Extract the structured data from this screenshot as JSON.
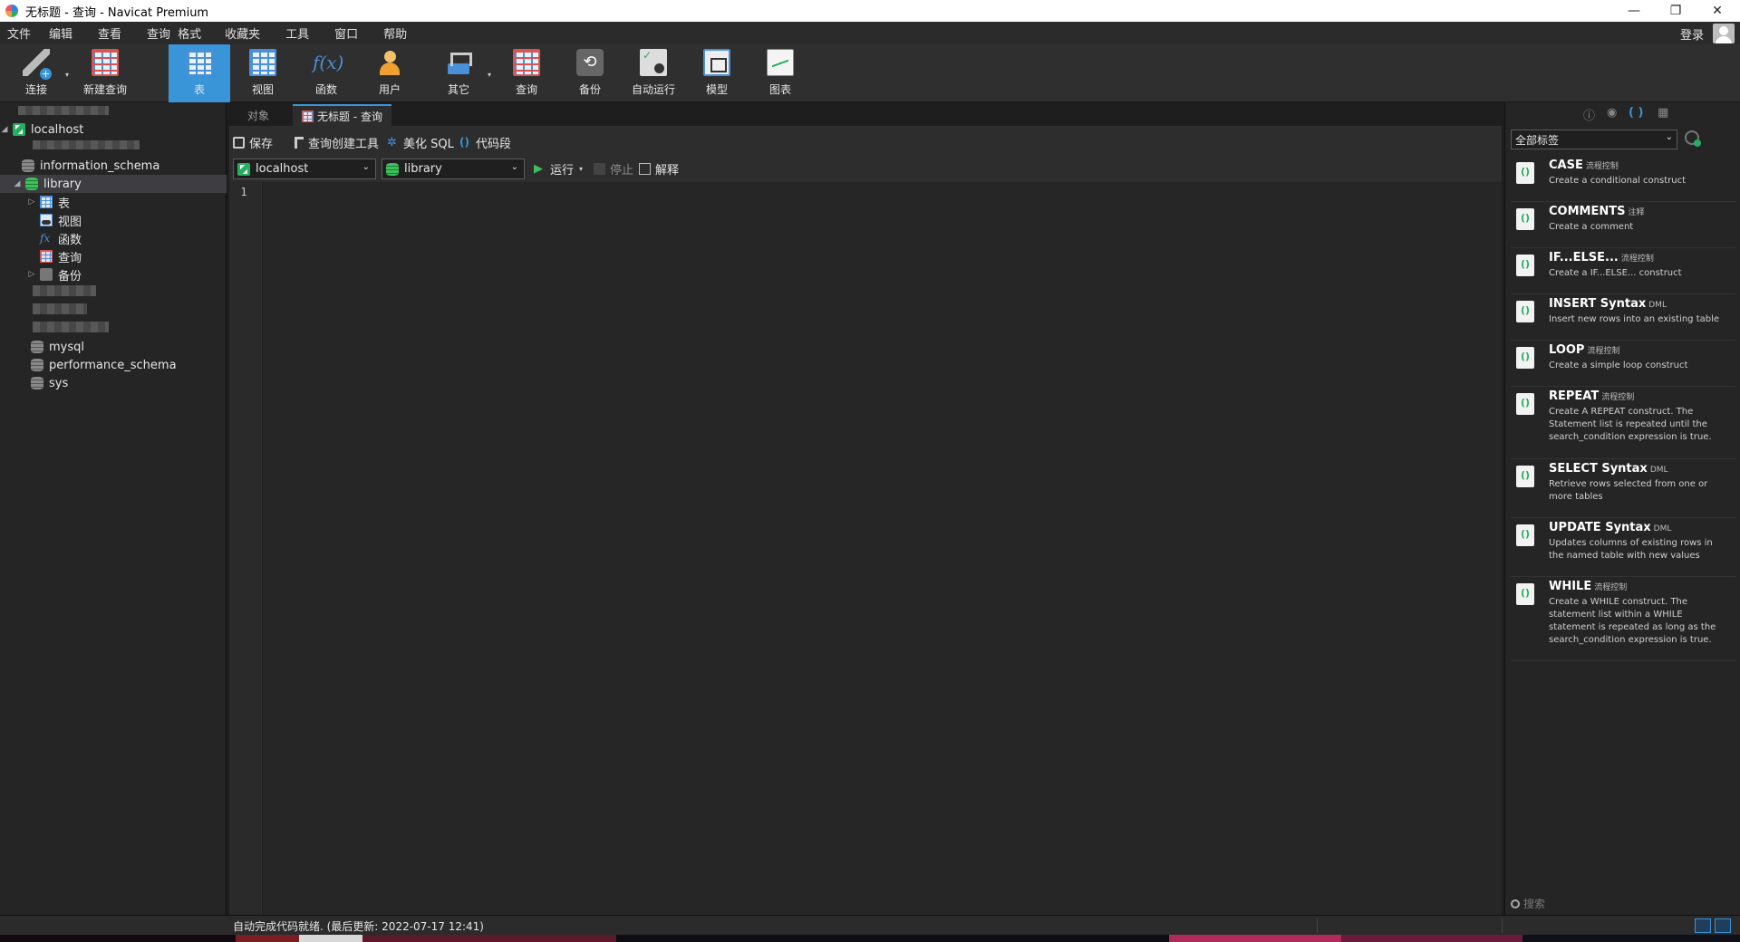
{
  "window": {
    "title": "无标题 - 查询 - Navicat Premium",
    "minimize_glyph": "—",
    "restore_glyph": "❐",
    "close_glyph": "✕"
  },
  "menu": {
    "items": [
      "文件",
      "编辑",
      "查看",
      "查询",
      "格式",
      "收藏夹",
      "工具",
      "窗口",
      "帮助"
    ],
    "login": "登录"
  },
  "toolbar": {
    "buttons": [
      {
        "label": "连接",
        "icon": "connection-plug-icon"
      },
      {
        "label": "新建查询",
        "icon": "new-query-icon"
      },
      {
        "label": "表",
        "icon": "table-icon",
        "active": true
      },
      {
        "label": "视图",
        "icon": "view-icon"
      },
      {
        "label": "函数",
        "icon": "function-icon"
      },
      {
        "label": "用户",
        "icon": "user-icon"
      },
      {
        "label": "其它",
        "icon": "other-tools-icon"
      },
      {
        "label": "查询",
        "icon": "query-icon"
      },
      {
        "label": "备份",
        "icon": "backup-icon"
      },
      {
        "label": "自动运行",
        "icon": "automation-icon"
      },
      {
        "label": "模型",
        "icon": "model-icon"
      },
      {
        "label": "图表",
        "icon": "chart-icon"
      }
    ],
    "fx_glyph": "f(x)",
    "dropdown_glyph": "▾"
  },
  "tree": {
    "host": "localhost",
    "dbs_top": [
      "information_schema"
    ],
    "open_db": "library",
    "children": [
      "表",
      "视图",
      "函数",
      "查询",
      "备份"
    ],
    "dbs_bottom": [
      "mysql",
      "performance_schema",
      "sys"
    ],
    "fx_glyph": "fx",
    "expand_glyph": "▷",
    "expanded_glyph": "◢"
  },
  "tabs": {
    "objects": "对象",
    "query": "无标题 - 查询"
  },
  "editor_toolbar": {
    "save": "保存",
    "query_builder": "查询创建工具",
    "beautify": "美化 SQL",
    "snippet": "代码段",
    "connection": "localhost",
    "database": "library",
    "run": "运行",
    "stop": "停止",
    "explain": "解释",
    "run_glyph": "▶",
    "chevron_glyph": "⌄"
  },
  "editor": {
    "line_numbers": [
      "1"
    ]
  },
  "snippets_panel": {
    "header_icons": [
      "ⓘ",
      "◉",
      "( )",
      "▦"
    ],
    "filter": "全部标签",
    "items": [
      {
        "title": "CASE",
        "tag": "流程控制",
        "desc": "Create a conditional construct"
      },
      {
        "title": "COMMENTS",
        "tag": "注释",
        "desc": "Create a comment"
      },
      {
        "title": "IF...ELSE...",
        "tag": "流程控制",
        "desc": "Create a IF...ELSE... construct"
      },
      {
        "title": "INSERT Syntax",
        "tag": "DML",
        "desc": "Insert new rows into an existing table"
      },
      {
        "title": "LOOP",
        "tag": "流程控制",
        "desc": "Create a simple loop construct"
      },
      {
        "title": "REPEAT",
        "tag": "流程控制",
        "desc": "Create A REPEAT construct. The Statement list is repeated until the search_condition expression is true."
      },
      {
        "title": "SELECT Syntax",
        "tag": "DML",
        "desc": "Retrieve rows selected from one or more tables"
      },
      {
        "title": "UPDATE Syntax",
        "tag": "DML",
        "desc": "Updates columns of existing rows in the named table with new values"
      },
      {
        "title": "WHILE",
        "tag": "流程控制",
        "desc": "Create a WHILE construct. The statement list within a WHILE statement is repeated as long as the search_condition expression is true."
      }
    ],
    "search_placeholder": "搜索"
  },
  "status": {
    "text": "自动完成代码就绪. (最后更新: 2022-07-17 12:41)"
  }
}
